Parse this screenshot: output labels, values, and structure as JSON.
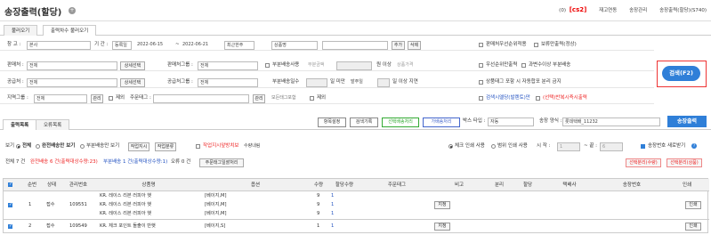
{
  "header": {
    "title": "송장출력(할당)",
    "badge_count": "(0)",
    "badge_user": "[cs2]",
    "link_inventory": "재고연동",
    "link_invoice_mgmt": "송장관리",
    "link_current": "송장출력(할당)(S740)"
  },
  "top_tabs": [
    "불러오기",
    "출력차수 불러오기"
  ],
  "filters": {
    "warehouse_label": "창 고 :",
    "warehouse_value": "본사",
    "period_label": "기 간 :",
    "date_type": "등록일",
    "date_from": "2022-06-15",
    "date_sep": "~",
    "date_to": "2022-06-21",
    "date_range": "최근한주",
    "product_name_select": "상품명",
    "add_button": "추가",
    "delete_button": "삭제",
    "chk_seller_priority": "판매처우선순위적용",
    "chk_hold_shipping": "보류만출력(정상)",
    "seller_label": "판매처 :",
    "seller_value": "전체",
    "detail_select": "상세선택",
    "seller_group_label": "판매처그룹 :",
    "seller_group_value": "전체",
    "chk_partial_use": "부분배송사용",
    "partial_amount": "부분금액",
    "won_above": "원 이상",
    "product_price": "상품가격",
    "chk_priority_ship": "우선순위만출력",
    "chk_over_qty_partial": "과변수이상 부분배송",
    "supplier_label": "공급처 :",
    "supplier_value": "전체",
    "supplier_group_label": "공급처그룹 :",
    "supplier_group_value": "전체",
    "partial_days_label": "부분배송일수",
    "days_suffix": "일 미만",
    "order_date": "발주일",
    "days_over_delay": "일 이상 지연",
    "chk_product_tag": "상품태그 포함 시 자동합포 분리 금지",
    "region_group_label": "지역그룹 :",
    "region_group_value": "전체",
    "manage_button": "관리",
    "chk_exclude": "제외",
    "order_tag_label": "주문태그 :",
    "manage_button2": "관리",
    "all_tags": "모든태그포함",
    "chk_exclude2": "제외",
    "chk_inspection_issue": "검색시엘당(발렌토)만",
    "chk_hold_force": "(선택)반복시즉시출력"
  },
  "search_button": "검색(F2)",
  "list_tabs": [
    "출력목록",
    "오류목록"
  ],
  "toolbar": {
    "item_settings": "항목설정",
    "print_hist": "검색기록",
    "select_print": "선택배송처리",
    "temp_print": "가배송처리",
    "box_type_label": "박스 타입 :",
    "box_type_value": "자동",
    "invoice_type_label": "송장 양식 :",
    "invoice_type_value": "롯데택배_11232",
    "ship_button": "송장출력"
  },
  "options": {
    "view_label": "보기",
    "radio_all": "전체",
    "radio_full": "완전배송만 보기",
    "radio_partial": "부분배송만 보기",
    "btn_set_order": "작업지시",
    "btn_set_sort": "작업분류",
    "chk_work_list": "작업지시앞방치보",
    "qty_sort": "수량내림",
    "radio_check_print": "체크 인쇄 사용",
    "radio_range_print": "범위 인쇄 사용",
    "start_label": "시 작 :",
    "start_value": "1",
    "end_label": "~ 끝 :",
    "end_value": "6",
    "chk_new_invoice": "송장번호 새로받기"
  },
  "summary": {
    "all": "전체 7 건",
    "full": "완전배송 6 건(출력대상수량:23)",
    "partial": "부분배송 1 건(출력대상수량:1)",
    "error": "오류 0 건",
    "btn_tag": "주문태그일괄처리",
    "btn_sel_remove": "선택분리(수량)",
    "btn_sel_combine": "선택분리(상품)"
  },
  "table": {
    "headers": [
      "순번",
      "상태",
      "관리번호",
      "상품명",
      "옵션",
      "수량",
      "할당수량",
      "주문태그",
      "비고",
      "분리",
      "할당",
      "택배사",
      "송장번호",
      "인쇄"
    ],
    "rows": [
      {
        "no": "1",
        "status": "접수",
        "id": "109551",
        "items": [
          {
            "name": "KR. 레이스 리본 러피아 햇",
            "option": "[베이지,M]",
            "qty": "9",
            "alloc": "1"
          },
          {
            "name": "KR. 레이스 리본 러피아 햇",
            "option": "[베이지,M]",
            "qty": "9",
            "alloc": "1"
          },
          {
            "name": "KR. 레이스 리본 러피아 햇",
            "option": "[베이지,M]",
            "qty": "9",
            "alloc": "1"
          }
        ],
        "tag_button": "지정",
        "print_button": "인쇄"
      },
      {
        "no": "2",
        "status": "접수",
        "id": "109549",
        "items": [
          {
            "name": "KR. 체크 포인트 돌출이 반햇",
            "option": "[베이지,S]",
            "qty": "1",
            "alloc": "1"
          }
        ],
        "tag_button": "지정",
        "print_button": "인쇄"
      }
    ]
  }
}
